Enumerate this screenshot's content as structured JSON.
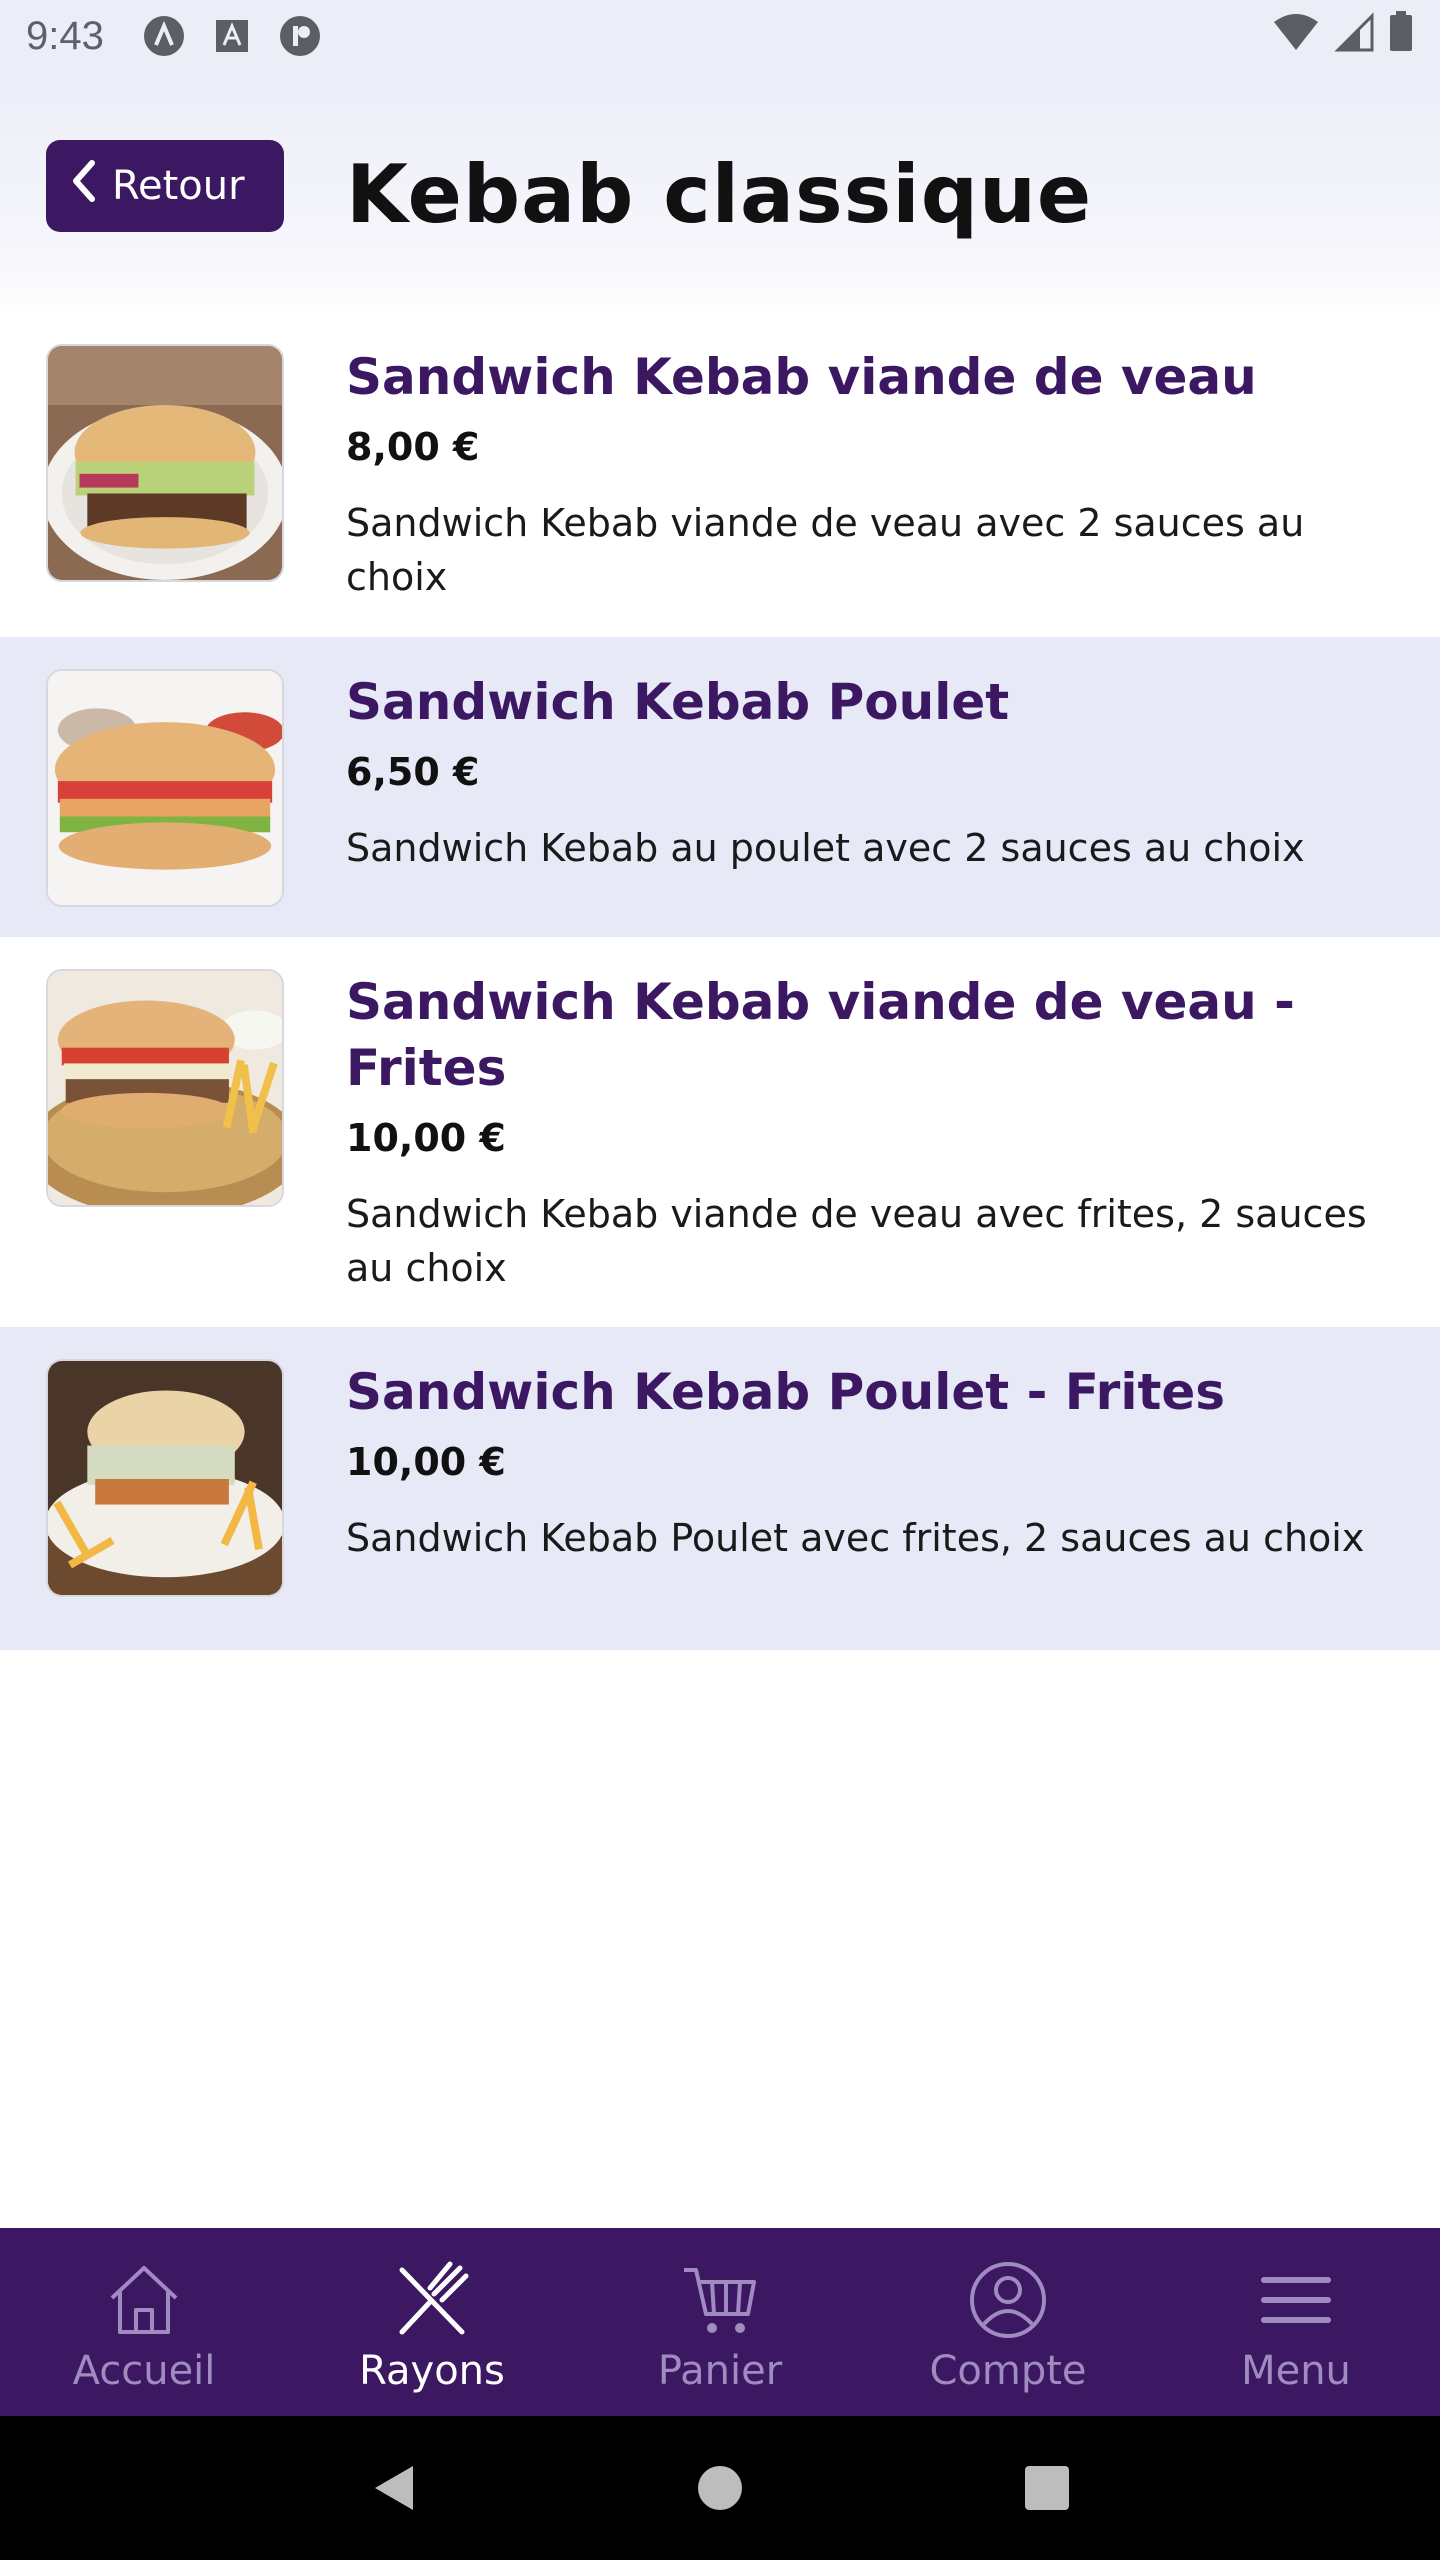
{
  "status_bar": {
    "time": "9:43",
    "notification_icons": [
      "a-icon",
      "text-box-icon",
      "p-icon"
    ],
    "right_icons": [
      "wifi-icon",
      "signal-icon",
      "battery-icon"
    ]
  },
  "header": {
    "back_label": "Retour",
    "title": "Kebab classique"
  },
  "products": [
    {
      "name": "Sandwich Kebab viande de veau",
      "price": "8,00 €",
      "description": "Sandwich Kebab viande de veau avec 2 sauces au choix",
      "image": "kebab-veal-photo"
    },
    {
      "name": "Sandwich Kebab Poulet",
      "price": "6,50 €",
      "description": "Sandwich Kebab au poulet avec 2 sauces au choix",
      "image": "kebab-chicken-photo"
    },
    {
      "name": "Sandwich Kebab viande de veau - Frites",
      "price": "10,00 €",
      "description": "Sandwich Kebab viande de veau avec frites, 2 sauces au choix",
      "image": "kebab-veal-fries-photo"
    },
    {
      "name": "Sandwich Kebab Poulet - Frites",
      "price": "10,00 €",
      "description": "Sandwich Kebab Poulet avec frites, 2 sauces au choix",
      "image": "kebab-chicken-fries-photo"
    }
  ],
  "bottom_nav": {
    "items": [
      {
        "label": "Accueil",
        "icon": "home-icon"
      },
      {
        "label": "Rayons",
        "icon": "utensils-icon"
      },
      {
        "label": "Panier",
        "icon": "cart-icon"
      },
      {
        "label": "Compte",
        "icon": "account-icon"
      },
      {
        "label": "Menu",
        "icon": "menu-icon"
      }
    ],
    "active_label": "Rayons"
  },
  "system_nav": [
    "back-icon",
    "home-circle-icon",
    "recents-icon"
  ],
  "colors": {
    "brand": "#3c1863",
    "row_alt": "#e7e9f7",
    "nav_inactive": "#a08bc0"
  }
}
